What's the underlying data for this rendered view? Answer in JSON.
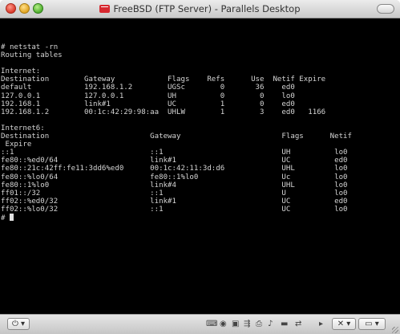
{
  "window": {
    "title": "FreeBSD (FTP Server) - Parallels Desktop"
  },
  "terminal": {
    "lines": [
      "# netstat -rn",
      "Routing tables",
      "",
      "Internet:",
      "Destination        Gateway            Flags    Refs      Use  Netif Expire",
      "default            192.168.1.2        UGSc        0       36    ed0",
      "127.0.0.1          127.0.0.1          UH          0        0    lo0",
      "192.168.1          link#1             UC          1        0    ed0",
      "192.168.1.2        00:1c:42:29:98:aa  UHLW        1        3    ed0   1166",
      "",
      "Internet6:",
      "Destination                       Gateway                       Flags      Netif",
      " Expire",
      "::1                               ::1                           UH          lo0",
      "fe80::%ed0/64                     link#1                        UC          ed0",
      "fe80::21c:42ff:fe11:3dd6%ed0      00:1c:42:11:3d:d6             UHL         lo0",
      "fe80::%lo0/64                     fe80::1%lo0                   Uc          lo0",
      "fe80::1%lo0                       link#4                        UHL         lo0",
      "ff01::/32                         ::1                           U           lo0",
      "ff02::%ed0/32                     link#1                        UC          ed0",
      "ff02::%lo0/32                     ::1                           UC          lo0",
      "# "
    ]
  },
  "toolbar": {
    "power_label": "⏻ ▾",
    "tools_label": "✕ ▾",
    "view_label": "▭ ▾",
    "device_icons": [
      "keyboard-icon",
      "cdrom-icon",
      "floppy-icon",
      "usb-icon",
      "printer-icon",
      "sound-icon",
      "hdd-icon",
      "network-icon",
      "play-icon"
    ]
  }
}
